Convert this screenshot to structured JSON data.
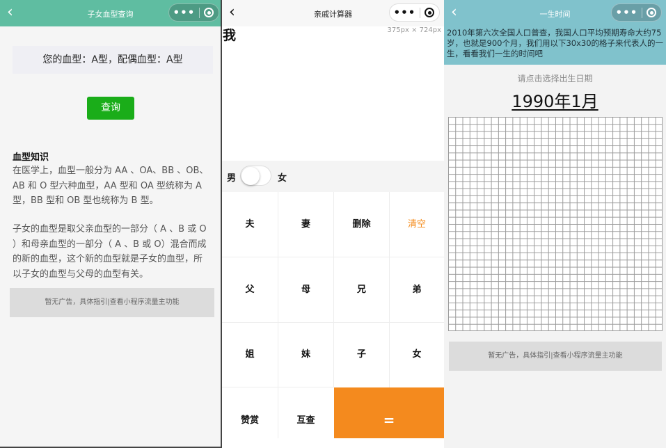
{
  "blood_page": {
    "nav_title": "子女血型查询",
    "blood_summary": "您的血型：A型，配偶血型：A型",
    "query_button": "查询",
    "knowledge_title": "血型知识",
    "knowledge_p1": "在医学上，血型一般分为 AA 、OA、BB 、OB、AB 和 O 型六种血型，AA 型和 OA 型统称为 A 型，BB 型和 OB 型也统称为 B 型。",
    "knowledge_p2": "子女的血型是取父亲血型的一部分（ A 、B 或 O ）和母亲血型的一部分（ A 、B 或 O）混合而成的新的血型，这个新的血型就是子女的血型，所以子女的血型与父母的血型有关。",
    "ad_text": "暂无广告，具体指引|查看小程序流量主功能"
  },
  "relative_page": {
    "nav_title": "亲戚计算器",
    "size_note": "375px × 724px",
    "me_label": "我",
    "gender_male": "男",
    "gender_female": "女",
    "keys": {
      "husband": "夫",
      "wife": "妻",
      "delete": "删除",
      "clear": "清空",
      "father": "父",
      "mother": "母",
      "elder_brother": "兄",
      "younger_brother": "弟",
      "elder_sister": "姐",
      "younger_sister": "妹",
      "son": "子",
      "daughter": "女",
      "tip": "赞赏",
      "mutual": "互查",
      "equals": "="
    },
    "accent_color": "#f48a1e"
  },
  "life_page": {
    "nav_title": "一生时间",
    "intro_text": "2010年第六次全国人口普查，我国人口平均预期寿命大约75岁，也就是900个月，我们用以下30x30的格子来代表人的一生，看看我们一生的时间吧",
    "hint": "请点击选择出生日期",
    "birth_date": "1990年1月",
    "ad_text": "暂无广告，具体指引|查看小程序流量主功能",
    "grid_rows": 30,
    "grid_cols": 30
  },
  "capsule": {
    "more_icon": "more-dots-icon",
    "close_icon": "target-circle-icon"
  },
  "colors": {
    "teal_green": "#5fbda1",
    "light_teal": "#80c2cc",
    "wechat_green": "#1aad19"
  }
}
